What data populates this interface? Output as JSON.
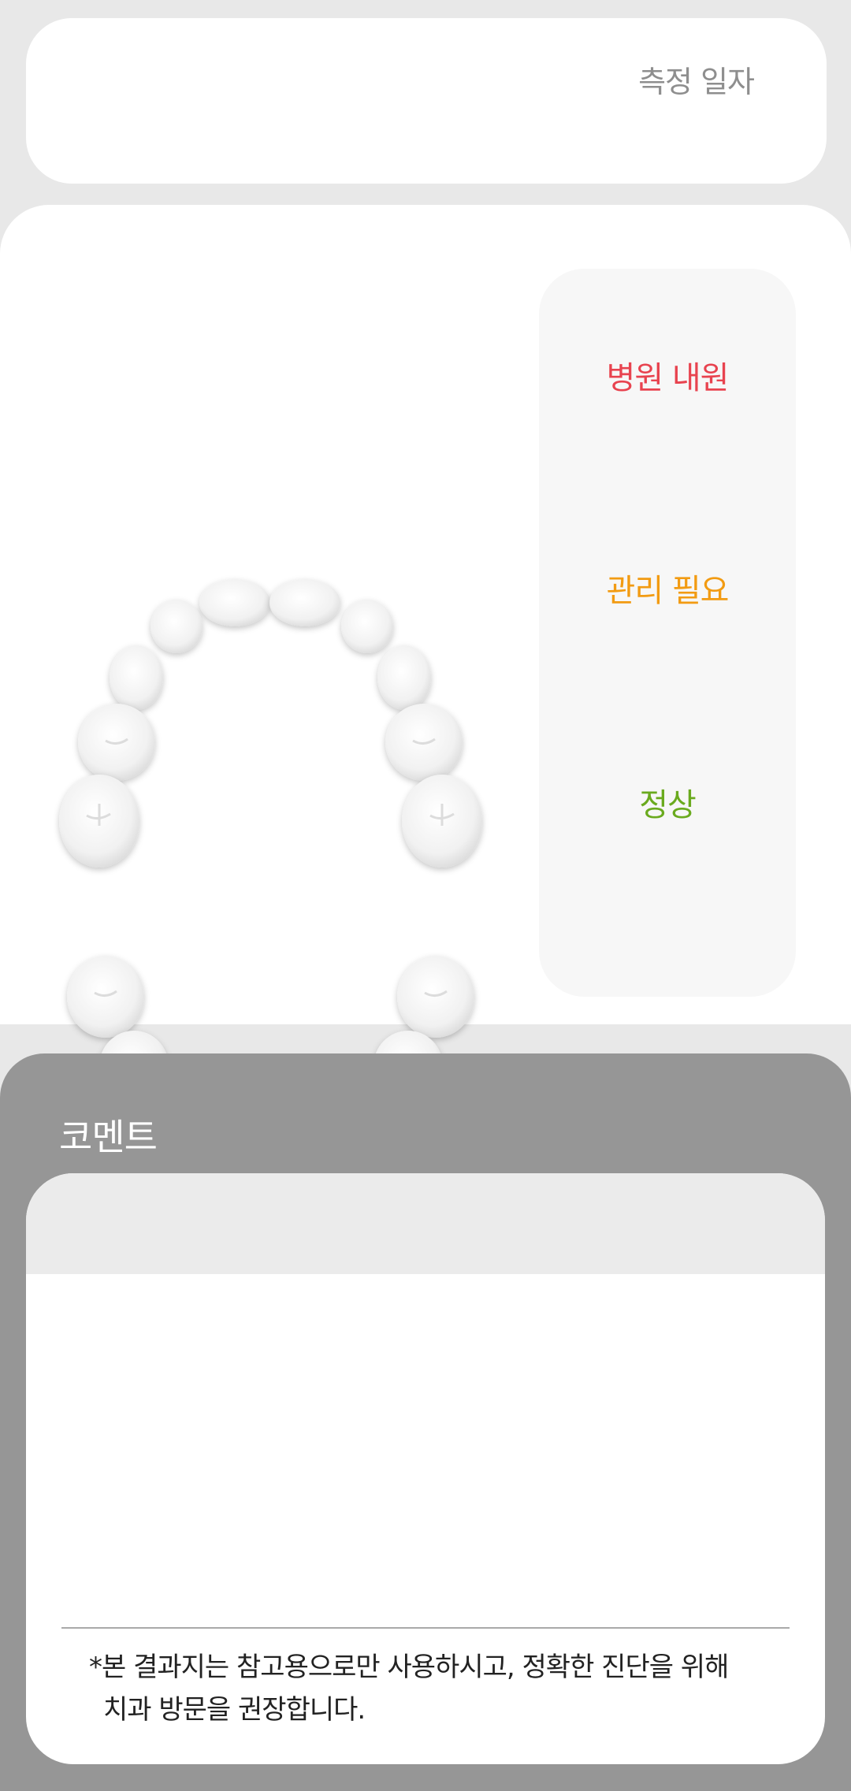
{
  "header": {
    "date_label": "측정 일자"
  },
  "legend": {
    "hospital_visit": {
      "label": "병원 내원",
      "color": "#e8434f"
    },
    "needs_care": {
      "label": "관리 필요",
      "color": "#f29b12"
    },
    "normal": {
      "label": "정상",
      "color": "#6aaa1e"
    }
  },
  "comment": {
    "title": "코멘트",
    "disclaimer_line1": "*본 결과지는 참고용으로만 사용하시고, 정확한 진단을 위해",
    "disclaimer_line2": "치과 방문을 권장합니다."
  }
}
